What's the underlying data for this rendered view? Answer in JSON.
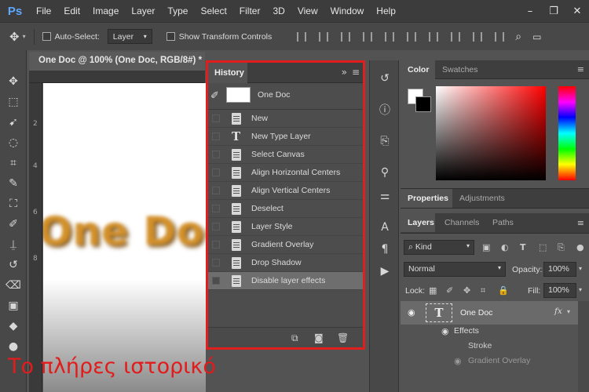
{
  "menubar": {
    "logo": "Ps",
    "items": [
      "File",
      "Edit",
      "Image",
      "Layer",
      "Type",
      "Select",
      "Filter",
      "3D",
      "View",
      "Window",
      "Help"
    ]
  },
  "options": {
    "auto_select_label": "Auto-Select:",
    "auto_select_value": "Layer",
    "transform_label": "Show Transform Controls"
  },
  "document": {
    "tab_title": "One Doc @ 100% (One Doc, RGB/8#) *",
    "canvas_text": "One Doc",
    "ruler_marks": [
      "2",
      "4",
      "6",
      "8"
    ]
  },
  "history": {
    "tab": "History",
    "snapshot": "One Doc",
    "states": [
      {
        "label": "New",
        "icon": "doc"
      },
      {
        "label": "New Type Layer",
        "icon": "type"
      },
      {
        "label": "Select Canvas",
        "icon": "doc"
      },
      {
        "label": "Align Horizontal Centers",
        "icon": "doc"
      },
      {
        "label": "Align Vertical Centers",
        "icon": "doc"
      },
      {
        "label": "Deselect",
        "icon": "doc"
      },
      {
        "label": "Layer Style",
        "icon": "doc"
      },
      {
        "label": "Gradient Overlay",
        "icon": "doc"
      },
      {
        "label": "Drop Shadow",
        "icon": "doc"
      },
      {
        "label": "Disable layer effects",
        "icon": "doc",
        "active": true
      }
    ]
  },
  "color_panel": {
    "tabs": [
      "Color",
      "Swatches"
    ]
  },
  "properties_panel": {
    "tabs": [
      "Properties",
      "Adjustments"
    ]
  },
  "layers_panel": {
    "tabs": [
      "Layers",
      "Channels",
      "Paths"
    ],
    "filter": "Kind",
    "blend_mode": "Normal",
    "opacity_label": "Opacity:",
    "opacity_value": "100%",
    "lock_label": "Lock:",
    "fill_label": "Fill:",
    "fill_value": "100%",
    "layer_name": "One Doc",
    "fx": "fx",
    "effects_label": "Effects",
    "effect_items": [
      "Stroke",
      "Gradient Overlay"
    ]
  },
  "caption": "Το πλήρες ιστορικό",
  "colors": {
    "highlight_border": "#e01e1e",
    "caption": "#e21b1b",
    "text_orange": "#d2902a"
  }
}
